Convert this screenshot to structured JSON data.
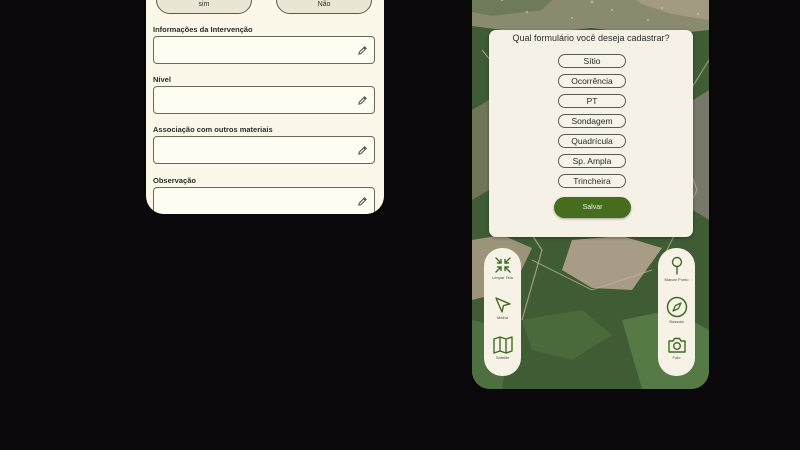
{
  "form_screen": {
    "toggle": {
      "yes_label": "sim",
      "no_label": "Não"
    },
    "fields": [
      {
        "label": "Informações da Intervenção",
        "value": ""
      },
      {
        "label": "Nível",
        "value": ""
      },
      {
        "label": "Associação com outros materiais",
        "value": ""
      },
      {
        "label": "Observação",
        "value": ""
      }
    ]
  },
  "map_screen": {
    "dialog": {
      "title": "Qual formulário você deseja cadastrar?",
      "options": [
        "Sítio",
        "Ocorrência",
        "PT",
        "Sondagem",
        "Quadrícula",
        "Sp. Ampla",
        "Trincheira"
      ],
      "save_label": "Salvar"
    },
    "left_toolbar": [
      {
        "label": "Limpar Tela",
        "icon": "shrink-arrows-icon"
      },
      {
        "label": "Malha",
        "icon": "navigation-arrow-icon"
      },
      {
        "label": "Satélite",
        "icon": "map-icon"
      }
    ],
    "right_toolbar": [
      {
        "label": "Marcar Ponto",
        "icon": "map-pin-icon"
      },
      {
        "label": "Bússola",
        "icon": "compass-icon"
      },
      {
        "label": "Foto",
        "icon": "camera-icon"
      }
    ]
  },
  "colors": {
    "background": "#0b080c",
    "form_bg": "#fbf8ea",
    "accent_green": "#466d1d",
    "dialog_bg": "#f6f1e6"
  }
}
